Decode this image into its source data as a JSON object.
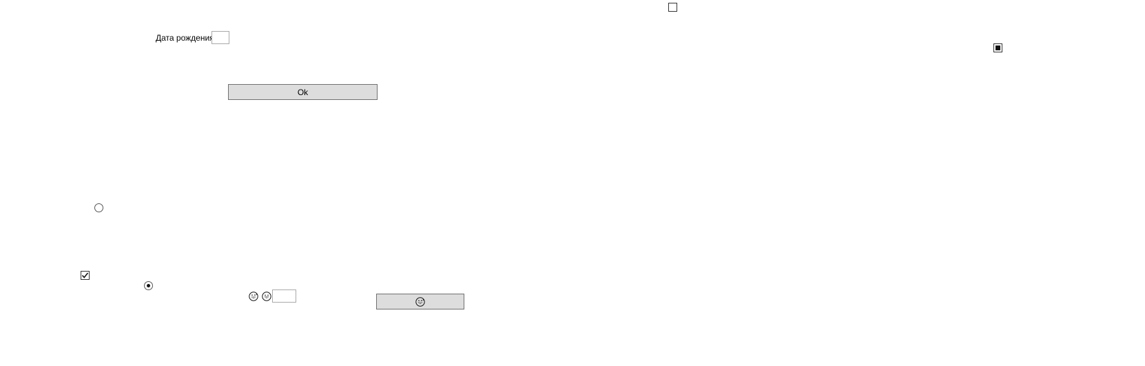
{
  "form": {
    "birth_date_label": "Дата рождения",
    "birth_date_value": "",
    "ok_button_label": "Ok",
    "emoji_input_value": ""
  },
  "checkboxes": {
    "top_checkbox_state": "unchecked",
    "right_checkbox_state": "indeterminate",
    "bottom_checkbox_state": "checked"
  },
  "radios": {
    "upper_radio_state": "unselected",
    "lower_radio_state": "selected"
  },
  "icons": {
    "emoji_a": "grinning-face-with-sweat-icon",
    "emoji_b": "grinning-face-icon",
    "emoji_button": "grinning-face-with-sweat-icon"
  }
}
